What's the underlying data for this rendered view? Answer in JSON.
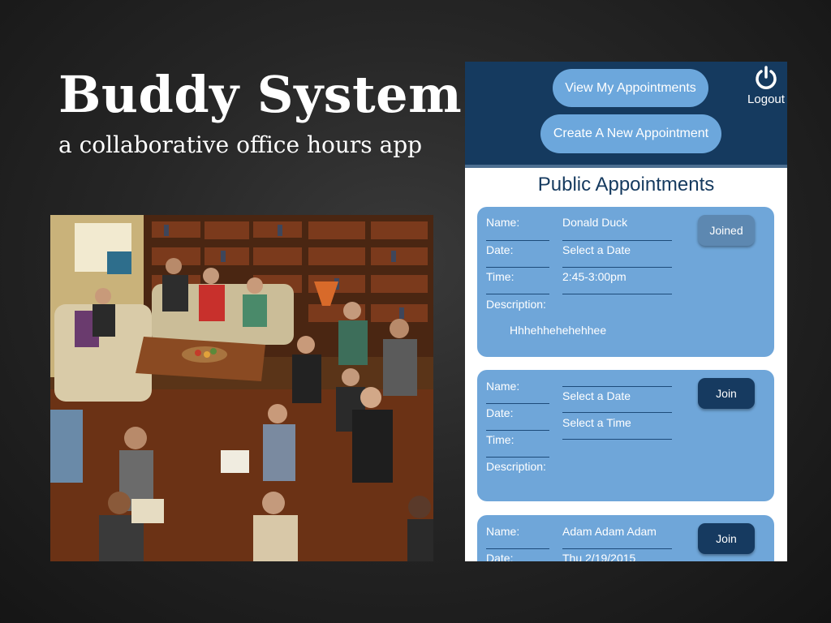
{
  "slide": {
    "title": "Buddy System",
    "subtitle": "a collaborative office hours app"
  },
  "photo": {
    "description": "group of students sitting in a living room with bookshelves"
  },
  "app": {
    "header": {
      "view_button": "View My Appointments",
      "create_button": "Create A New Appointment",
      "logout_label": "Logout"
    },
    "section_title": "Public Appointments",
    "appointments": [
      {
        "name_label": "Name:",
        "name": "Donald Duck",
        "date_label": "Date:",
        "date": "Select a Date",
        "time_label": "Time:",
        "time": "2:45-3:00pm",
        "description_label": "Description:",
        "description": "Hhhehhehehehhee",
        "action": "Joined"
      },
      {
        "name_label": "Name:",
        "name": "",
        "date_label": "Date:",
        "date": "Select a Date",
        "time_label": "Time:",
        "time": "Select a Time",
        "description_label": "Description:",
        "description": "",
        "action": "Join"
      },
      {
        "name_label": "Name:",
        "name": "Adam Adam Adam",
        "date_label": "Date:",
        "date": "Thu 2/19/2015",
        "action": "Join"
      }
    ]
  },
  "colors": {
    "header_bg": "#153a5f",
    "pill_button": "#6ca7dc",
    "card_bg": "#6fa6d9",
    "join_button": "#163a60",
    "joined_button": "#5d88b1"
  },
  "icons": {
    "logout": "power-icon"
  }
}
